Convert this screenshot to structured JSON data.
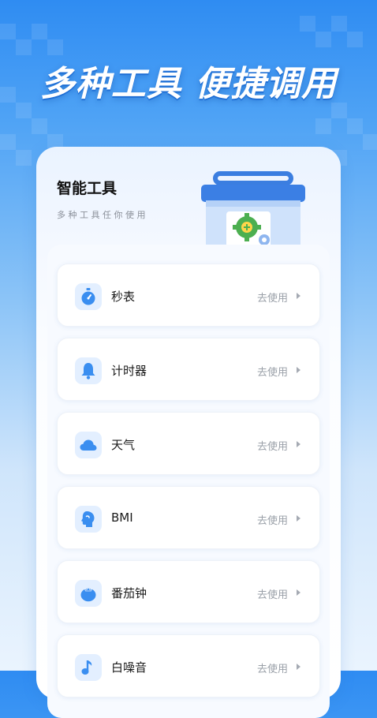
{
  "hero": {
    "title": "多种工具 便捷调用"
  },
  "card": {
    "title": "智能工具",
    "subtitle": "多种工具任你使用"
  },
  "tools": [
    {
      "label": "秒表",
      "action": "去使用",
      "icon": "stopwatch-icon"
    },
    {
      "label": "计时器",
      "action": "去使用",
      "icon": "bell-icon"
    },
    {
      "label": "天气",
      "action": "去使用",
      "icon": "cloud-icon"
    },
    {
      "label": "BMI",
      "action": "去使用",
      "icon": "head-profile-icon"
    },
    {
      "label": "番茄钟",
      "action": "去使用",
      "icon": "tomato-icon"
    },
    {
      "label": "白噪音",
      "action": "去使用",
      "icon": "music-note-icon"
    }
  ],
  "colors": {
    "accent": "#3a8ef0",
    "icon_bg": "#e3efff",
    "gear": "#4caf50"
  }
}
